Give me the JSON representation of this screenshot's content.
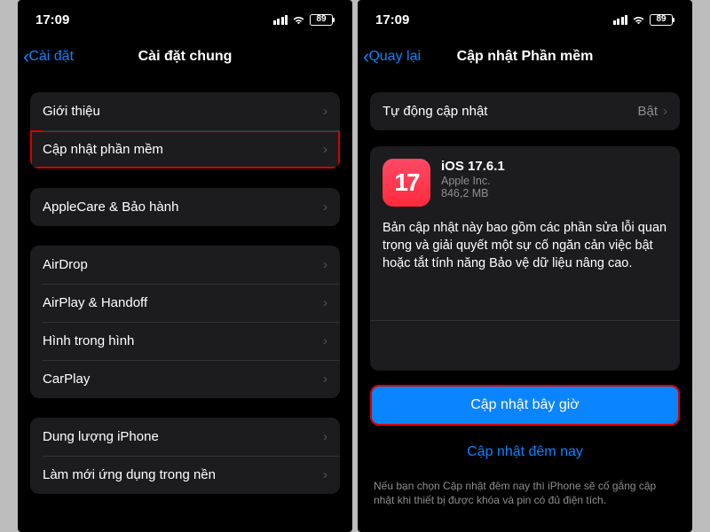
{
  "status": {
    "time": "17:09",
    "battery": "89"
  },
  "left": {
    "back": "Cài đặt",
    "title": "Cài đặt chung",
    "g1": {
      "about": "Giới thiệu",
      "sw": "Cập nhật phần mềm"
    },
    "g2": {
      "applecare": "AppleCare & Bảo hành"
    },
    "g3": {
      "airdrop": "AirDrop",
      "airplay": "AirPlay & Handoff",
      "pip": "Hình trong hình",
      "carplay": "CarPlay"
    },
    "g4": {
      "storage": "Dung lượng iPhone",
      "bgapp": "Làm mới ứng dụng trong nền"
    }
  },
  "right": {
    "back": "Quay lại",
    "title": "Cập nhật Phần mềm",
    "autolabel": "Tự động cập nhật",
    "autovalue": "Bật",
    "update": {
      "icon_text": "17",
      "name": "iOS 17.6.1",
      "vendor": "Apple Inc.",
      "size": "846,2 MB",
      "desc": "Bản cập nhật này bao gồm các phần sửa lỗi quan trọng và giải quyết một sự cố ngăn cản việc bật hoặc tắt tính năng Bảo vệ dữ liệu nâng cao.",
      "cta": "Cập nhật bây giờ",
      "tonight": "Cập nhật đêm nay",
      "foot": "Nếu bạn chọn Cập nhật đêm nay thì iPhone sẽ cố gắng cập nhật khi thiết bị được khóa và pin có đủ điện tích."
    }
  }
}
